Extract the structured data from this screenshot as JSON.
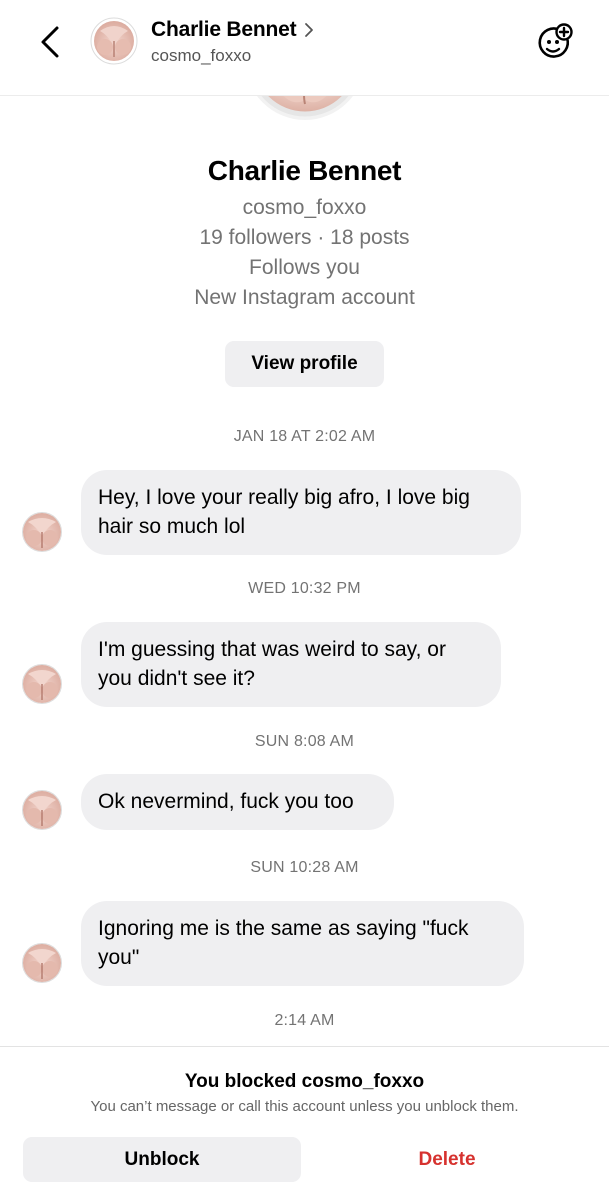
{
  "header": {
    "name": "Charlie Bennet",
    "username": "cosmo_foxxo",
    "back_icon": "chevron-left-icon",
    "chevron_icon": "chevron-right-icon",
    "effects_icon": "face-plus-icon"
  },
  "profile": {
    "name": "Charlie Bennet",
    "username": "cosmo_foxxo",
    "stats": "19 followers · 18 posts",
    "follows_you": "Follows you",
    "account_note": "New Instagram account",
    "view_profile_label": "View profile"
  },
  "thread": [
    {
      "time": "JAN 18 AT 2:02 AM",
      "lines": [
        "Hey, I love your really big afro, I love big",
        "hair so much lol"
      ]
    },
    {
      "time": "WED 10:32 PM",
      "lines": [
        "I'm guessing that was weird to say, or",
        "you didn't see it?"
      ]
    },
    {
      "time": "SUN 8:08 AM",
      "lines": [
        "Ok nevermind, fuck you too"
      ]
    },
    {
      "time": "SUN 10:28 AM",
      "lines": [
        "Ignoring me is the same as saying \"fuck",
        "you\""
      ]
    },
    {
      "time": "2:14 AM",
      "lines": []
    }
  ],
  "blocked": {
    "title": "You blocked cosmo_foxxo",
    "subtitle": "You can’t message or call this account unless you unblock them.",
    "unblock_label": "Unblock",
    "delete_label": "Delete"
  },
  "colors": {
    "bubble": "#efeff1",
    "delete": "#d6322f",
    "secondary_text": "#737373"
  }
}
